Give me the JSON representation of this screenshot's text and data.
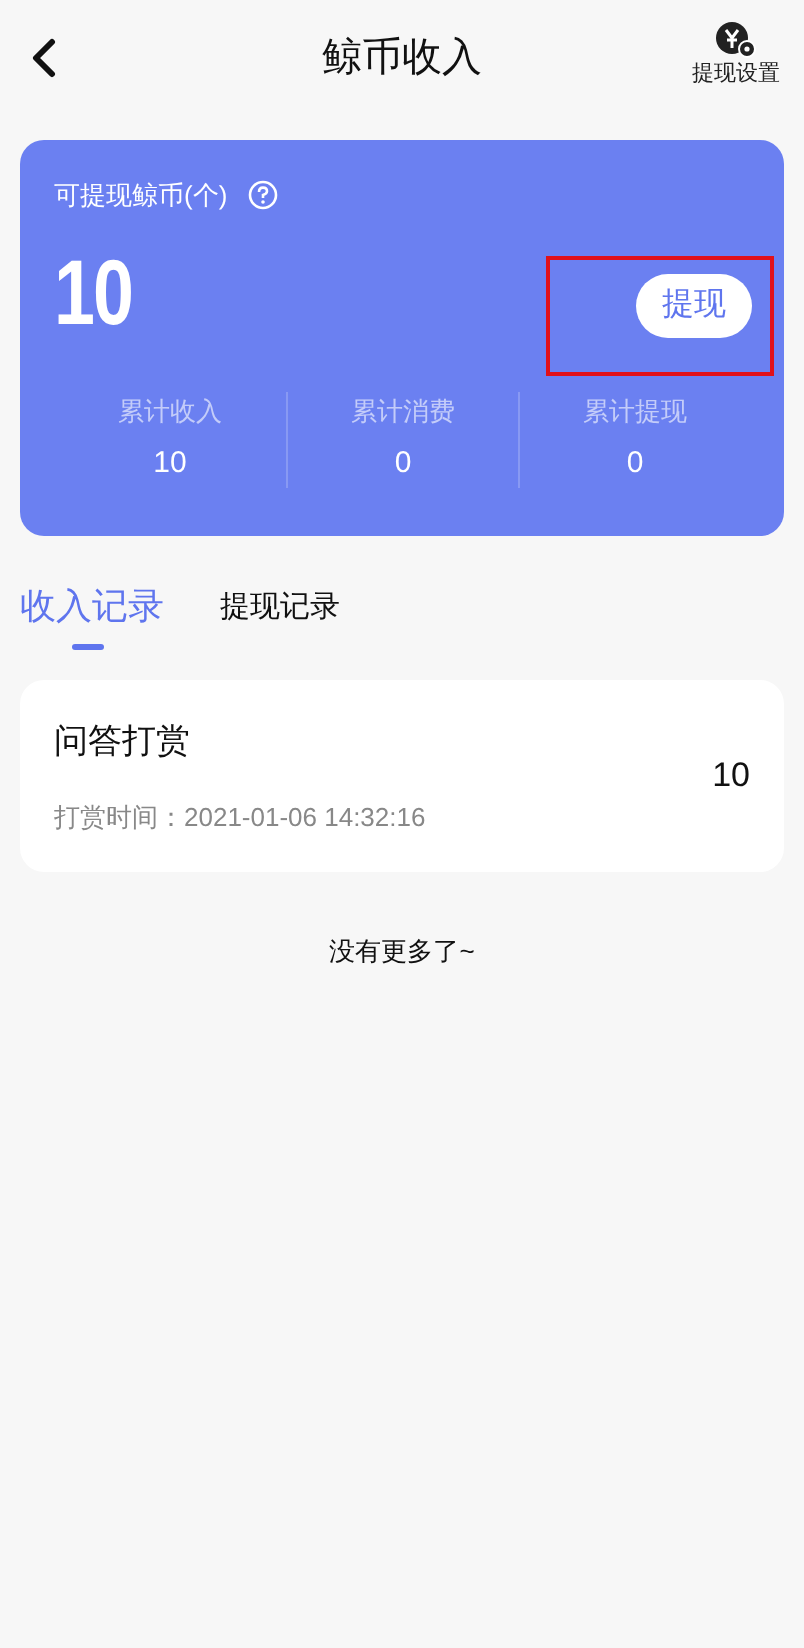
{
  "header": {
    "title": "鲸币收入",
    "settings_label": "提现设置"
  },
  "balance_card": {
    "label": "可提现鲸币(个)",
    "amount": "10",
    "withdraw_button": {
      "label": "提现",
      "highlighted": true
    },
    "stats": [
      {
        "label": "累计收入",
        "value": "10"
      },
      {
        "label": "累计消费",
        "value": "0"
      },
      {
        "label": "累计提现",
        "value": "0"
      }
    ]
  },
  "tabs": [
    {
      "label": "收入记录",
      "selected": true
    },
    {
      "label": "提现记录",
      "selected": false
    }
  ],
  "records": [
    {
      "title": "问答打赏",
      "time": "打赏时间：2021-01-06 14:32:16",
      "amount": "10"
    }
  ],
  "footer_note": "没有更多了~"
}
